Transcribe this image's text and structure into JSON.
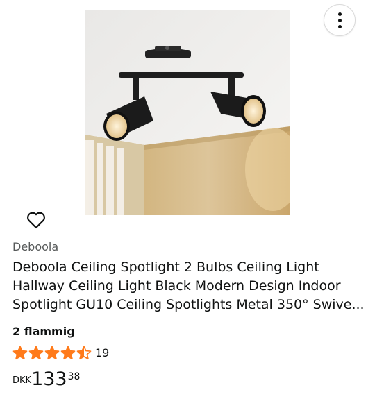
{
  "product": {
    "brand": "Deboola",
    "title": "Deboola Ceiling Spotlight 2 Bulbs Ceiling Light Hallway Ceiling Light Black Modern Design Indoor Spotlight GU10 Ceiling Spotlights Metal 350° Swive...",
    "variant": "2 flammig",
    "rating": 4.5,
    "rating_count": "19",
    "price": {
      "currency": "DKK",
      "whole": "133",
      "fraction": "38"
    }
  },
  "icons": {
    "more": "more-vertical-icon",
    "wishlist": "heart-outline-icon",
    "star": "star-icon"
  },
  "colors": {
    "star": "#ff7a1a",
    "text": "#0f1111",
    "muted": "#565959"
  }
}
